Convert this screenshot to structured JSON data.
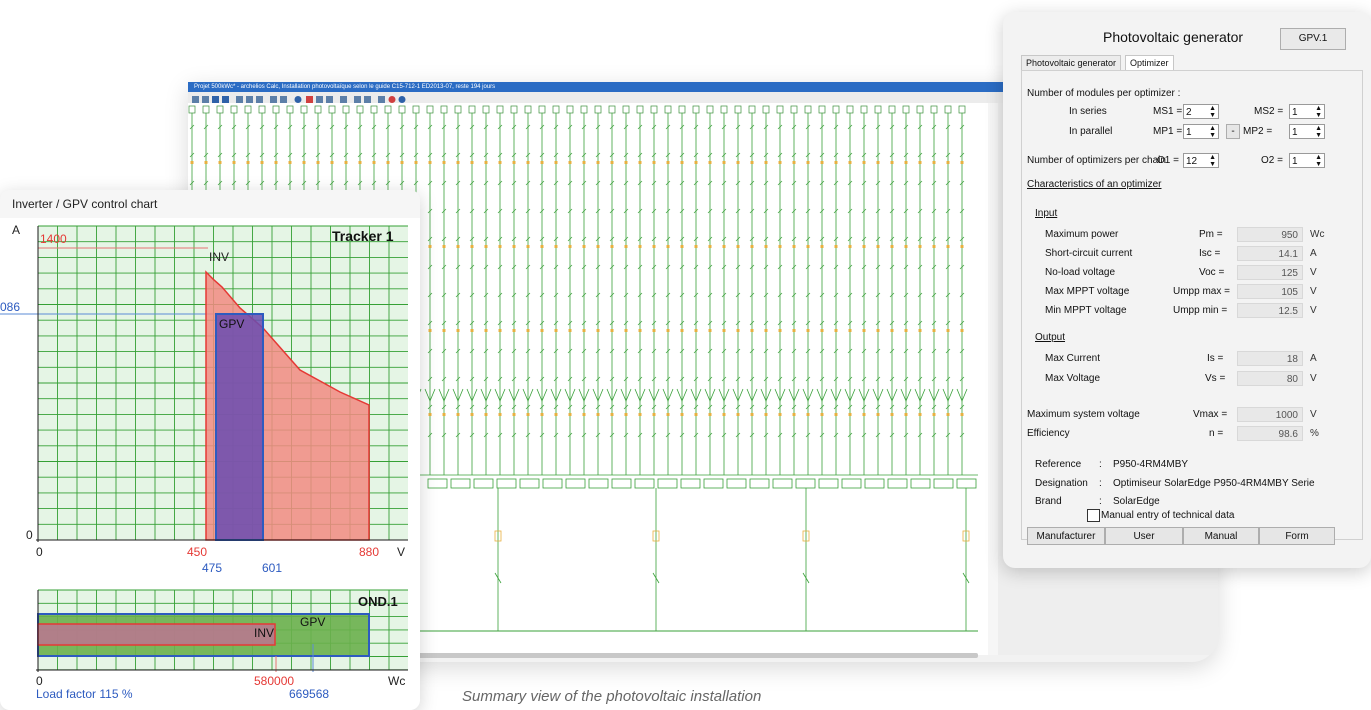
{
  "schematic": {
    "window_title": "Projet 500kWc* - archelios Calc, Installation photovoltaïque selon le guide C15-712-1 ED2013-07, reste 194 jours"
  },
  "caption": "Summary view of the photovoltaic installation",
  "control_chart": {
    "window_title": "Inverter / GPV control chart",
    "tracker": {
      "title": "Tracker 1",
      "y_axis_label": "A",
      "x_axis_label": "V",
      "y_max_label": "1400",
      "y_mid_label": "086",
      "y_zero_label": "0",
      "x_zero_label": "0",
      "x_labels_red": [
        "450",
        "880"
      ],
      "x_labels_blue": [
        "475",
        "601"
      ],
      "inv_label": "INV",
      "gpv_label": "GPV"
    },
    "inverter": {
      "title": "OND.1",
      "x_zero_label": "0",
      "x_red_label": "580000",
      "x_blue_label": "669568",
      "x_unit": "Wc",
      "inv_label": "INV",
      "gpv_label": "GPV",
      "load_factor": "Load factor 115 %"
    }
  },
  "chart_data": [
    {
      "type": "area",
      "title": "Tracker 1",
      "xlabel": "V",
      "ylabel": "A",
      "series": [
        {
          "name": "INV",
          "x": [
            450,
            450,
            475,
            601,
            700,
            780,
            880,
            880
          ],
          "y": [
            0,
            1400,
            1300,
            1086,
            850,
            750,
            680,
            0
          ]
        },
        {
          "name": "GPV",
          "x": [
            475,
            601
          ],
          "y": [
            0,
            1086
          ]
        }
      ],
      "ylim": [
        0,
        1500
      ],
      "xlim": [
        0,
        900
      ]
    },
    {
      "type": "bar",
      "title": "OND.1",
      "xlabel": "Wc",
      "categories": [
        "INV",
        "GPV"
      ],
      "values": [
        580000,
        669568
      ]
    }
  ],
  "dialog": {
    "title": "Photovoltaic generator",
    "id_button": "GPV.1",
    "tabs": [
      "Photovoltaic generator",
      "Optimizer"
    ],
    "modules_heading": "Number of modules per optimizer :",
    "in_series": "In series",
    "in_parallel": "In parallel",
    "ms1_label": "MS1 =",
    "ms1_value": "2",
    "ms2_label": "MS2 =",
    "ms2_value": "1",
    "mp1_label": "MP1 =",
    "mp1_value": "1",
    "dash_button": "-",
    "mp2_label": "MP2 =",
    "mp2_value": "1",
    "optimizers_label": "Number of optimizers per chain",
    "o1_label": "O1 =",
    "o1_value": "12",
    "o2_label": "O2 =",
    "o2_value": "1",
    "characteristics_heading": "Characteristics of an optimizer",
    "input_heading": "Input",
    "output_heading": "Output",
    "rows_input": [
      {
        "label": "Maximum power",
        "symbol": "Pm =",
        "value": "950",
        "unit": "Wc"
      },
      {
        "label": "Short-circuit current",
        "symbol": "Isc =",
        "value": "14.1",
        "unit": "A"
      },
      {
        "label": "No-load voltage",
        "symbol": "Voc =",
        "value": "125",
        "unit": "V"
      },
      {
        "label": "Max MPPT voltage",
        "symbol": "Umpp max =",
        "value": "105",
        "unit": "V"
      },
      {
        "label": "Min MPPT voltage",
        "symbol": "Umpp min =",
        "value": "12.5",
        "unit": "V"
      }
    ],
    "rows_output": [
      {
        "label": "Max Current",
        "symbol": "Is =",
        "value": "18",
        "unit": "A"
      },
      {
        "label": "Max Voltage",
        "symbol": "Vs =",
        "value": "80",
        "unit": "V"
      }
    ],
    "rows_system": [
      {
        "label": "Maximum system voltage",
        "symbol": "Vmax =",
        "value": "1000",
        "unit": "V"
      },
      {
        "label": "Efficiency",
        "symbol": "n =",
        "value": "98.6",
        "unit": "%"
      }
    ],
    "reference_label": "Reference",
    "reference_value": "P950-4RM4MBY",
    "designation_label": "Designation",
    "designation_value": "Optimiseur SolarEdge P950-4RM4MBY Serie",
    "brand_label": "Brand",
    "brand_value": "SolarEdge",
    "colon": ":",
    "manual_entry_label": "Manual entry of technical data",
    "buttons": [
      "Manufacturer",
      "User",
      "Manual",
      "Form"
    ]
  }
}
